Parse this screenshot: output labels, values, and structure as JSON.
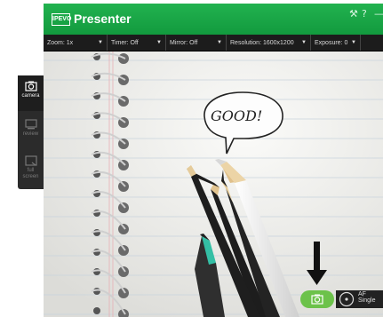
{
  "app": {
    "logo_text": "IPEVO",
    "title": "Presenter",
    "controls": {
      "settings": "⚒",
      "help": "?",
      "minimize": "—"
    }
  },
  "toolbar": {
    "zoom": "Zoom: 1x",
    "timer": "Timer: Off",
    "mirror": "Mirror: Off",
    "resolution": "Resolution: 1600x1200",
    "exposure": "Exposure: 0"
  },
  "sidebar": {
    "items": [
      {
        "label": "camera",
        "icon": "camera-icon",
        "active": true
      },
      {
        "label": "review",
        "icon": "review-icon",
        "active": false
      },
      {
        "label": "full\nscreen",
        "icon": "fullscreen-icon",
        "active": false
      }
    ]
  },
  "bottom": {
    "af_mode": "AF",
    "af_detail": "Single"
  },
  "preview": {
    "speech_text": "GOOD!"
  },
  "colors": {
    "accent": "#22b24f",
    "capture": "#6cc24a"
  }
}
